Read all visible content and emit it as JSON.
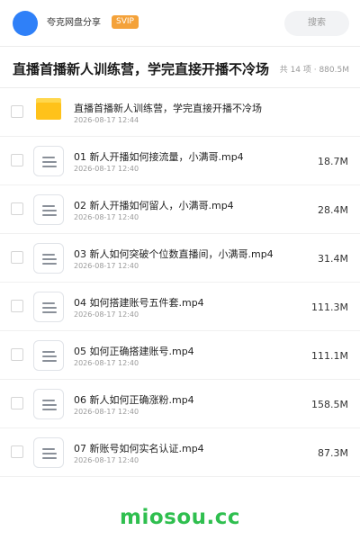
{
  "header": {
    "brand": "夸克网盘分享",
    "badge": "SVIP",
    "search_placeholder": "搜索"
  },
  "share": {
    "title": "直播首播新人训练营，学完直接开播不冷场",
    "meta": "共 14 项 · 880.5M"
  },
  "rows": [
    {
      "type": "folder",
      "name": "直播首播新人训练营，学完直接开播不冷场",
      "date": "2026-08-17 12:44",
      "size": ""
    },
    {
      "type": "file",
      "name": "01 新人开播如何接流量，小满哥.mp4",
      "date": "2026-08-17 12:40",
      "size": "18.7M"
    },
    {
      "type": "file",
      "name": "02 新人开播如何留人，小满哥.mp4",
      "date": "2026-08-17 12:40",
      "size": "28.4M"
    },
    {
      "type": "file",
      "name": "03 新人如何突破个位数直播间，小满哥.mp4",
      "date": "2026-08-17 12:40",
      "size": "31.4M"
    },
    {
      "type": "file",
      "name": "04 如何搭建账号五件套.mp4",
      "date": "2026-08-17 12:40",
      "size": "111.3M"
    },
    {
      "type": "file",
      "name": "05 如何正确搭建账号.mp4",
      "date": "2026-08-17 12:40",
      "size": "111.1M"
    },
    {
      "type": "file",
      "name": "06 新人如何正确涨粉.mp4",
      "date": "2026-08-17 12:40",
      "size": "158.5M"
    },
    {
      "type": "file",
      "name": "07 新账号如何实名认证.mp4",
      "date": "2026-08-17 12:40",
      "size": "87.3M"
    }
  ],
  "watermark": "miosou.cc",
  "colors": {
    "avatar": "#2f80f8",
    "badge": "#f4a23a",
    "folder": "#ffc21a",
    "watermark": "#2fbf4f"
  }
}
